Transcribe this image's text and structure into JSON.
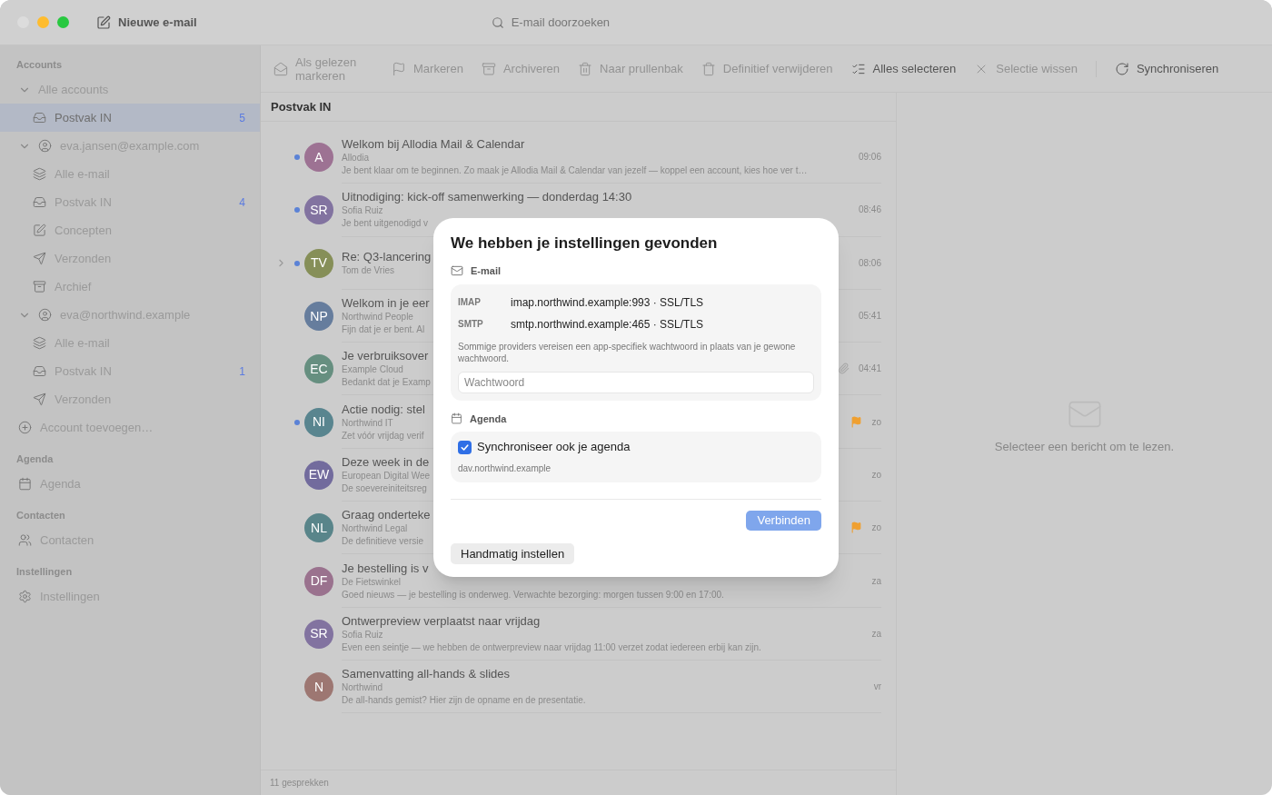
{
  "window": {
    "compose_button": "Nieuwe e-mail",
    "search": {
      "placeholder": "E-mail doorzoeken"
    }
  },
  "toolbar": [
    {
      "kind": "read",
      "label": "Als gelezen markeren",
      "disabled": true
    },
    {
      "kind": "flag",
      "label": "Markeren",
      "disabled": true
    },
    {
      "kind": "archive",
      "label": "Archiveren",
      "disabled": true
    },
    {
      "kind": "trash",
      "label": "Naar prullenbak",
      "disabled": true
    },
    {
      "kind": "delete",
      "label": "Definitief verwijderen",
      "disabled": true
    },
    {
      "kind": "selectall",
      "label": "Alles selecteren",
      "disabled": false
    },
    {
      "kind": "clear",
      "label": "Selectie wissen",
      "disabled": true
    },
    {
      "kind": "sync",
      "label": "Synchroniseren",
      "disabled": false
    }
  ],
  "sidebar": [
    {
      "heading": "Accounts",
      "items": [
        {
          "kind": "group",
          "label": "Alle accounts",
          "expanded": true,
          "selected": false,
          "children": [
            {
              "kind": "inbox",
              "label": "Postvak IN",
              "count": "5",
              "selected": true
            }
          ]
        },
        {
          "kind": "account",
          "label": "eva.jansen@example.com",
          "expanded": true,
          "selected": false,
          "children": [
            {
              "kind": "all",
              "label": "Alle e-mail",
              "selected": false
            },
            {
              "kind": "inbox",
              "label": "Postvak IN",
              "count": "4",
              "selected": false
            },
            {
              "kind": "drafts",
              "label": "Concepten",
              "selected": false
            },
            {
              "kind": "sent",
              "label": "Verzonden",
              "selected": false
            },
            {
              "kind": "archive",
              "label": "Archief",
              "selected": false
            }
          ]
        },
        {
          "kind": "account",
          "label": "eva@northwind.example",
          "expanded": true,
          "selected": false,
          "children": [
            {
              "kind": "all",
              "label": "Alle e-mail",
              "selected": false
            },
            {
              "kind": "inbox",
              "label": "Postvak IN",
              "count": "1",
              "selected": false
            },
            {
              "kind": "sent",
              "label": "Verzonden",
              "selected": false
            }
          ]
        },
        {
          "kind": "add",
          "label": "Account toevoegen…",
          "selected": false
        }
      ]
    },
    {
      "heading": "Agenda",
      "items": [
        {
          "kind": "calendar",
          "label": "Agenda",
          "selected": false
        }
      ]
    },
    {
      "heading": "Contacten",
      "items": [
        {
          "kind": "contacts",
          "label": "Contacten",
          "selected": false
        }
      ]
    },
    {
      "heading": "Instellingen",
      "items": [
        {
          "kind": "settings",
          "label": "Instellingen",
          "selected": false
        }
      ]
    }
  ],
  "list": {
    "title": "Postvak IN",
    "status": "11 gesprekken",
    "messages": [
      {
        "initials": "A",
        "color": "#9d7293",
        "subject": "Welkom bij Allodia Mail & Calendar",
        "sender": "Allodia",
        "preview": "Je bent klaar om te beginnen. Zo maak je Allodia Mail & Calendar van jezelf — koppel een account, kies hoe ver t…",
        "time": "09:06",
        "unread": true,
        "thread": false,
        "flagged": false,
        "attachment": false
      },
      {
        "initials": "SR",
        "color": "#8273a0",
        "subject": "Uitnodiging: kick-off samenwerking — donderdag 14:30",
        "sender": "Sofia Ruiz",
        "preview": "Je bent uitgenodigd v",
        "time": "08:46",
        "unread": true,
        "thread": false,
        "flagged": false,
        "attachment": false
      },
      {
        "initials": "TV",
        "color": "#868f58",
        "subject": "Re: Q3-lancering",
        "sender": "Tom de Vries",
        "time": "08:06",
        "unread": true,
        "thread": true,
        "flagged": false,
        "attachment": false
      },
      {
        "initials": "NP",
        "color": "#667d9d",
        "subject": "Welkom in je eer",
        "sender": "Northwind People",
        "preview": "Fijn dat je er bent. Al",
        "time": "05:41",
        "unread": false,
        "thread": false,
        "flagged": false,
        "attachment": false
      },
      {
        "initials": "EC",
        "color": "#668f80",
        "subject": "Je verbruiksover",
        "sender": "Example Cloud",
        "preview": "Bedankt dat je Examp",
        "time": "04:41",
        "unread": false,
        "thread": false,
        "flagged": false,
        "attachment": true
      },
      {
        "initials": "NI",
        "color": "#59858f",
        "subject": "Actie nodig: stel",
        "sender": "Northwind IT",
        "preview": "Zet vóór vrijdag verif",
        "time": "zo",
        "unread": true,
        "thread": false,
        "flagged": true,
        "attachment": false
      },
      {
        "initials": "EW",
        "color": "#726b9d",
        "subject": "Deze week in de",
        "sender": "European Digital Wee",
        "preview": "De soevereiniteitsreg",
        "time": "zo",
        "unread": false,
        "thread": false,
        "flagged": false,
        "attachment": false
      },
      {
        "initials": "NL",
        "color": "#59858a",
        "subject": "Graag onderteke",
        "sender": "Northwind Legal",
        "preview": "De definitieve versie",
        "time": "zo",
        "unread": false,
        "thread": false,
        "flagged": true,
        "attachment": false
      },
      {
        "initials": "DF",
        "color": "#9a728e",
        "subject": "Je bestelling is v",
        "sender": "De Fietswinkel",
        "preview": "Goed nieuws — je bestelling is onderweg. Verwachte bezorging: morgen tussen 9:00 en 17:00.",
        "time": "za",
        "unread": false,
        "thread": false,
        "flagged": false,
        "attachment": false
      },
      {
        "initials": "SR",
        "color": "#8273a0",
        "subject": "Ontwerpreview verplaatst naar vrijdag",
        "sender": "Sofia Ruiz",
        "preview": "Even een seintje — we hebben de ontwerpreview naar vrijdag 11:00 verzet zodat iedereen erbij kan zijn.",
        "time": "za",
        "unread": false,
        "thread": false,
        "flagged": false,
        "attachment": false
      },
      {
        "initials": "N",
        "color": "#9d7772",
        "subject": "Samenvatting all-hands & slides",
        "sender": "Northwind",
        "preview": "De all-hands gemist? Hier zijn de opname en de presentatie.",
        "time": "vr",
        "unread": false,
        "thread": false,
        "flagged": false,
        "attachment": false
      }
    ]
  },
  "reader": {
    "empty_text": "Selecteer een bericht om te lezen."
  },
  "dialog": {
    "title": "We hebben je instellingen gevonden",
    "email": {
      "heading": "E-mail",
      "servers": [
        {
          "protocol": "IMAP",
          "value": "imap.northwind.example:993 · SSL/TLS"
        },
        {
          "protocol": "SMTP",
          "value": "smtp.northwind.example:465 · SSL/TLS"
        }
      ],
      "note": "Sommige providers vereisen een app-specifiek wachtwoord in plaats van je gewone wachtwoord.",
      "password": {
        "placeholder": "Wachtwoord"
      }
    },
    "calendar": {
      "heading": "Agenda",
      "sync": {
        "label": "Synchroniseer ook je agenda",
        "checked": true
      },
      "server": "dav.northwind.example"
    },
    "connect": {
      "label": "Verbinden",
      "disabled": true
    },
    "manual": {
      "label": "Handmatig instellen"
    }
  }
}
